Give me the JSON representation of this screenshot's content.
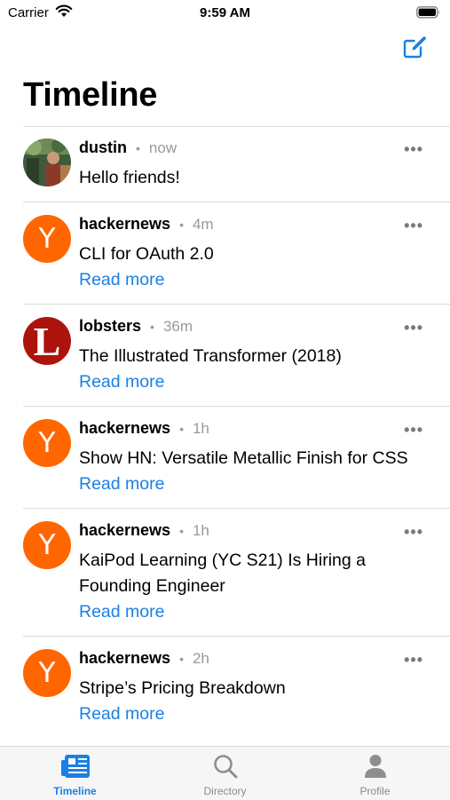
{
  "status_bar": {
    "carrier": "Carrier",
    "time": "9:59 AM"
  },
  "header": {
    "title": "Timeline",
    "compose_icon": "compose-icon"
  },
  "colors": {
    "accent": "#1a80e5",
    "hn_orange": "#ff6600",
    "lobsters_red": "#ac130d",
    "muted": "#999999"
  },
  "posts": [
    {
      "author": "dustin",
      "time": "now",
      "content": "Hello friends!",
      "read_more": "",
      "avatar": "photo"
    },
    {
      "author": "hackernews",
      "time": "4m",
      "content": "CLI for OAuth 2.0",
      "read_more": "Read more",
      "avatar": "Y"
    },
    {
      "author": "lobsters",
      "time": "36m",
      "content": "The Illustrated Transformer (2018)",
      "read_more": "Read more",
      "avatar": "L"
    },
    {
      "author": "hackernews",
      "time": "1h",
      "content": "Show HN: Versatile Metallic Finish for CSS",
      "read_more": "Read more",
      "avatar": "Y"
    },
    {
      "author": "hackernews",
      "time": "1h",
      "content": "KaiPod Learning (YC S21) Is Hiring a Founding Engineer",
      "read_more": "Read more",
      "avatar": "Y"
    },
    {
      "author": "hackernews",
      "time": "2h",
      "content": "Stripe’s Pricing Breakdown",
      "read_more": "Read more",
      "avatar": "Y"
    }
  ],
  "more_glyph": "•••",
  "separator": "•",
  "tabs": [
    {
      "label": "Timeline",
      "icon": "newspaper-icon",
      "active": true
    },
    {
      "label": "Directory",
      "icon": "search-icon",
      "active": false
    },
    {
      "label": "Profile",
      "icon": "person-icon",
      "active": false
    }
  ]
}
